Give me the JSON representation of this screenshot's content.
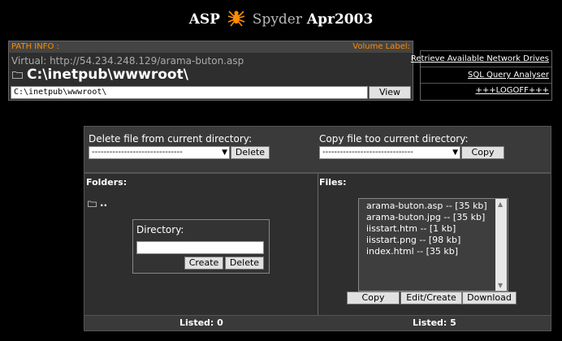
{
  "header": {
    "asp": "ASP",
    "spyder": "Spyder",
    "version": "Apr2003",
    "logo_icon": "spider-icon",
    "accent_color": "#ff8c00"
  },
  "path_info": {
    "heading": "PATH INFO :",
    "volume_label": "Volume Label:",
    "virtual": "Virtual: http://54.234.248.129/arama-buton.asp",
    "current_path": "C:\\inetpub\\wwwroot\\",
    "path_input_value": "C:\\inetpub\\wwwroot\\",
    "view_button": "View",
    "folder_icon": "folder-icon"
  },
  "links": {
    "network_drives": "Retrieve Available Network Drives",
    "sql_analyser": "SQL Query Analyser",
    "logoff": "+++LOGOFF+++"
  },
  "operations": {
    "delete_label": "Delete file from current directory:",
    "delete_select": "-------------------------------",
    "delete_button": "Delete",
    "copy_label": "Copy file too current directory:",
    "copy_select": "-------------------------------",
    "copy_button": "Copy"
  },
  "folders": {
    "heading": "Folders:",
    "parent": "..",
    "directory_label": "Directory:",
    "directory_input_value": "",
    "create_button": "Create",
    "delete_button": "Delete",
    "listed": "Listed: 0"
  },
  "files": {
    "heading": "Files:",
    "items": [
      "arama-buton.asp -- [35 kb]",
      "arama-buton.jpg -- [35 kb]",
      "iisstart.htm -- [1 kb]",
      "iisstart.png -- [98 kb]",
      "index.html -- [35 kb]"
    ],
    "copy_button": "Copy",
    "edit_button": "Edit/Create",
    "download_button": "Download",
    "listed": "Listed: 5"
  }
}
